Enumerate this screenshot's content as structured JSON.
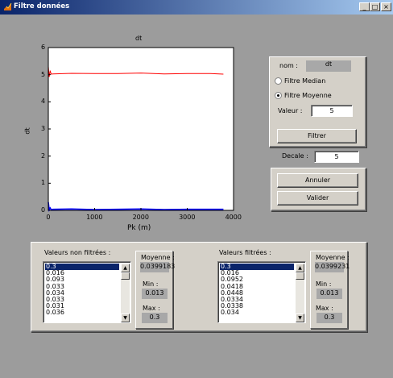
{
  "window": {
    "title": "Filtre données",
    "minimize": "_",
    "maximize": "□",
    "close": "×"
  },
  "chart_data": {
    "type": "line",
    "title": "dt",
    "xlabel": "Pk (m)",
    "ylabel": "dt",
    "xlim": [
      0,
      4000
    ],
    "ylim": [
      0,
      6
    ],
    "xticks": [
      "0",
      "1000",
      "2000",
      "3000",
      "4000"
    ],
    "yticks": [
      "0",
      "1",
      "2",
      "3",
      "4",
      "5",
      "6"
    ],
    "grid": false,
    "series": [
      {
        "color": "#ff0000",
        "x": [
          0,
          20,
          40,
          60,
          100,
          500,
          1000,
          1500,
          2000,
          2500,
          3000,
          3500,
          3780
        ],
        "y": [
          5.3,
          4.92,
          5.15,
          5.02,
          5.03,
          5.05,
          5.04,
          5.04,
          5.06,
          5.03,
          5.04,
          5.04,
          5.02
        ]
      },
      {
        "color": "#0000ff",
        "x": [
          0,
          20,
          40,
          60,
          100,
          500,
          1000,
          1500,
          2000,
          2500,
          3000,
          3500,
          3780
        ],
        "y": [
          0.3,
          0.02,
          0.09,
          0.03,
          0.04,
          0.05,
          0.03,
          0.04,
          0.05,
          0.03,
          0.04,
          0.04,
          0.04
        ]
      }
    ]
  },
  "controls": {
    "nom_label": "nom :",
    "nom_value": "dt",
    "radio_median": "Filtre Median",
    "radio_moyenne": "Filtre Moyenne",
    "valeur_label": "Valeur :",
    "valeur_value": "5",
    "filtrer_button": "Filtrer",
    "decale_label": "Decale :",
    "decale_value": "5",
    "annuler_button": "Annuler",
    "valider_button": "Valider"
  },
  "unfiltered": {
    "label": "Valeurs non filtrées :",
    "items": [
      "0.3",
      "0.016",
      "0.093",
      "0.033",
      "0.034",
      "0.033",
      "0.031",
      "0.036"
    ],
    "moyenne_label": "Moyenne :",
    "moyenne_value": "0.0399183",
    "min_label": "Min :",
    "min_value": "0.013",
    "max_label": "Max :",
    "max_value": "0.3"
  },
  "filtered": {
    "label": "Valeurs filtrées :",
    "items": [
      "0.3",
      "0.016",
      "0.0952",
      "0.0418",
      "0.0448",
      "0.0334",
      "0.0338",
      "0.034"
    ],
    "moyenne_label": "Moyenne :",
    "moyenne_value": "0.0399231",
    "min_label": "Min :",
    "min_value": "0.013",
    "max_label": "Max :",
    "max_value": "0.3"
  }
}
